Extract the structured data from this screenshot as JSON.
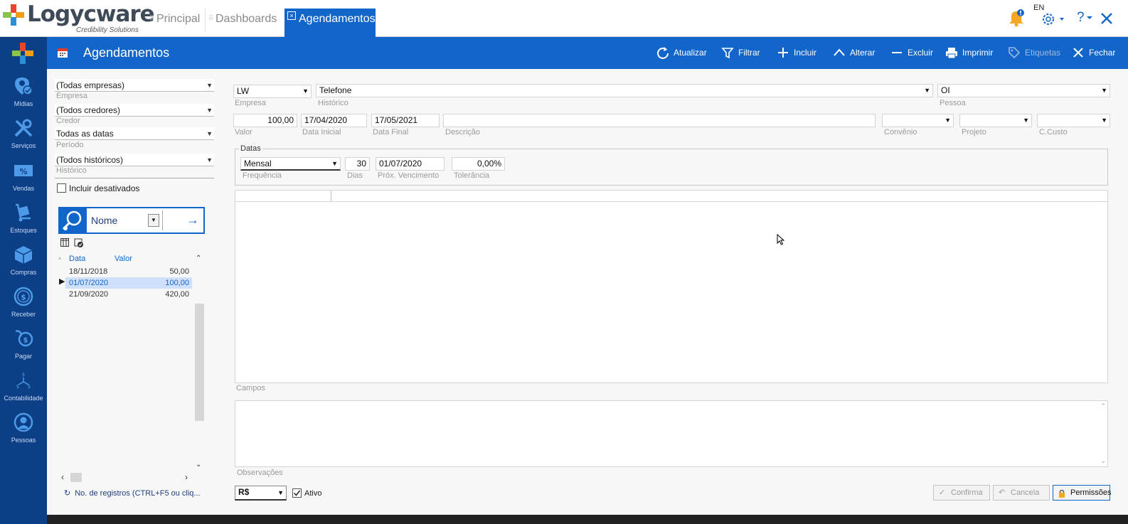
{
  "topbar": {
    "logo": {
      "name": "Logycware",
      "tagline": "Credibility Solutions"
    },
    "tabs": [
      {
        "label": "Principal"
      },
      {
        "label": "Dashboards"
      }
    ],
    "active_tab": {
      "label": "Agendamentos",
      "close_symbol": "×"
    },
    "language": "EN",
    "help_symbol": "?",
    "icons": [
      "bell-icon",
      "gear-icon",
      "help-icon",
      "close-icon"
    ]
  },
  "rail": {
    "items": [
      {
        "label": "Mídias",
        "icon": "media-icon"
      },
      {
        "label": "Serviços",
        "icon": "tools-icon"
      },
      {
        "label": "Vendas",
        "icon": "percent-icon"
      },
      {
        "label": "Estoques",
        "icon": "dolly-icon"
      },
      {
        "label": "Compras",
        "icon": "box-icon"
      },
      {
        "label": "Receber",
        "icon": "coin-icon"
      },
      {
        "label": "Pagar",
        "icon": "hand-coin-icon"
      },
      {
        "label": "Contabilidade",
        "icon": "ledger-icon"
      },
      {
        "label": "Pessoas",
        "icon": "person-icon"
      }
    ]
  },
  "header": {
    "title": "Agendamentos",
    "toolbar": [
      {
        "label": "Atualizar",
        "icon": "refresh-icon"
      },
      {
        "label": "Filtrar",
        "icon": "filter-icon"
      },
      {
        "label": "Incluir",
        "icon": "plus-icon"
      },
      {
        "label": "Alterar",
        "icon": "chevron-up-icon"
      },
      {
        "label": "Excluir",
        "icon": "minus-icon"
      },
      {
        "label": "Imprimir",
        "icon": "printer-icon"
      },
      {
        "label": "Etiquetas",
        "icon": "tag-icon",
        "disabled": true
      },
      {
        "label": "Fechar",
        "icon": "close-icon"
      }
    ]
  },
  "filters": {
    "empresa": {
      "value": "(Todas empresas)",
      "label": "Empresa"
    },
    "credor": {
      "value": "(Todos credores)",
      "label": "Credor"
    },
    "periodo": {
      "value": "Todas as datas",
      "label": "Período"
    },
    "historico": {
      "value": "(Todos históricos)",
      "label": "Histórico"
    },
    "incluir_desativados": {
      "label": "Incluir desativados",
      "checked": false
    },
    "search": {
      "field": "Nome"
    },
    "grid": {
      "columns": [
        "Data",
        "Valor"
      ],
      "rows": [
        {
          "data": "18/11/2018",
          "valor": "50,00",
          "selected": false
        },
        {
          "data": "01/07/2020",
          "valor": "100,00",
          "selected": true
        },
        {
          "data": "21/09/2020",
          "valor": "420,00",
          "selected": false
        }
      ]
    },
    "record_count": "No. de registros (CTRL+F5 ou cliq..."
  },
  "form": {
    "empresa": {
      "value": "LW",
      "label": "Empresa"
    },
    "historico": {
      "value": "Telefone",
      "label": "Histórico"
    },
    "pessoa": {
      "value": "OI",
      "label": "Pessoa"
    },
    "valor": {
      "value": "100,00",
      "label": "Valor"
    },
    "data_inicial": {
      "value": "17/04/2020",
      "label": "Data Inicial"
    },
    "data_final": {
      "value": "17/05/2021",
      "label": "Data Final"
    },
    "descricao": {
      "value": "",
      "label": "Descrição"
    },
    "convenio": {
      "value": "",
      "label": "Convênio"
    },
    "projeto": {
      "value": "",
      "label": "Projeto"
    },
    "ccusto": {
      "value": "",
      "label": "C.Custo"
    },
    "datas": {
      "title": "Datas",
      "frequencia": {
        "value": "Mensal",
        "label": "Frequência"
      },
      "dias": {
        "value": "30",
        "label": "Dias"
      },
      "prox_vencimento": {
        "value": "01/07/2020",
        "label": "Próx. Vencimento"
      },
      "tolerancia": {
        "value": "0,00%",
        "label": "Tolerância"
      }
    },
    "campos_label": "Campos",
    "observacoes_label": "Observações",
    "moeda": "R$",
    "ativo": {
      "label": "Ativo",
      "checked": true
    },
    "buttons": {
      "confirma": "Confirma",
      "cancela": "Cancela",
      "permissoes": "Permissões"
    }
  },
  "colors": {
    "primary": "#1366c9",
    "rail": "#0d3f86",
    "bell": "#f5a623"
  }
}
